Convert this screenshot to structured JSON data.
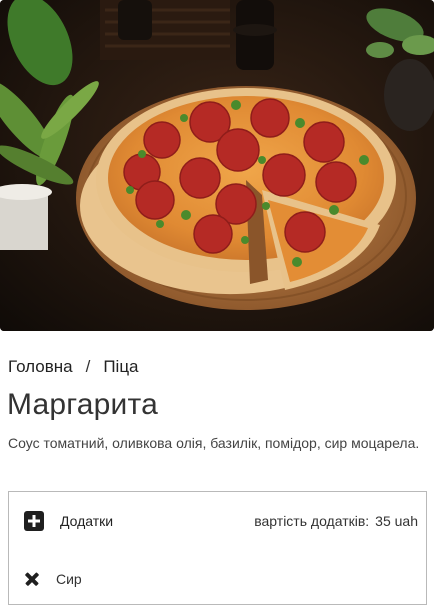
{
  "product": {
    "image_alt": "pizza",
    "title": "Маргарита",
    "description": "Соус томатний, оливкова олія, базилік, помідор, сир моцарела."
  },
  "breadcrumb": {
    "home": "Головна",
    "separator": "/",
    "current": "Піца"
  },
  "addons": {
    "label": "Додатки",
    "cost_label": "вартість додатків:",
    "cost_value": "35 uah",
    "items": [
      {
        "name": "Сир"
      }
    ]
  },
  "icons": {
    "add": "plus-square-icon",
    "remove": "close-icon"
  }
}
